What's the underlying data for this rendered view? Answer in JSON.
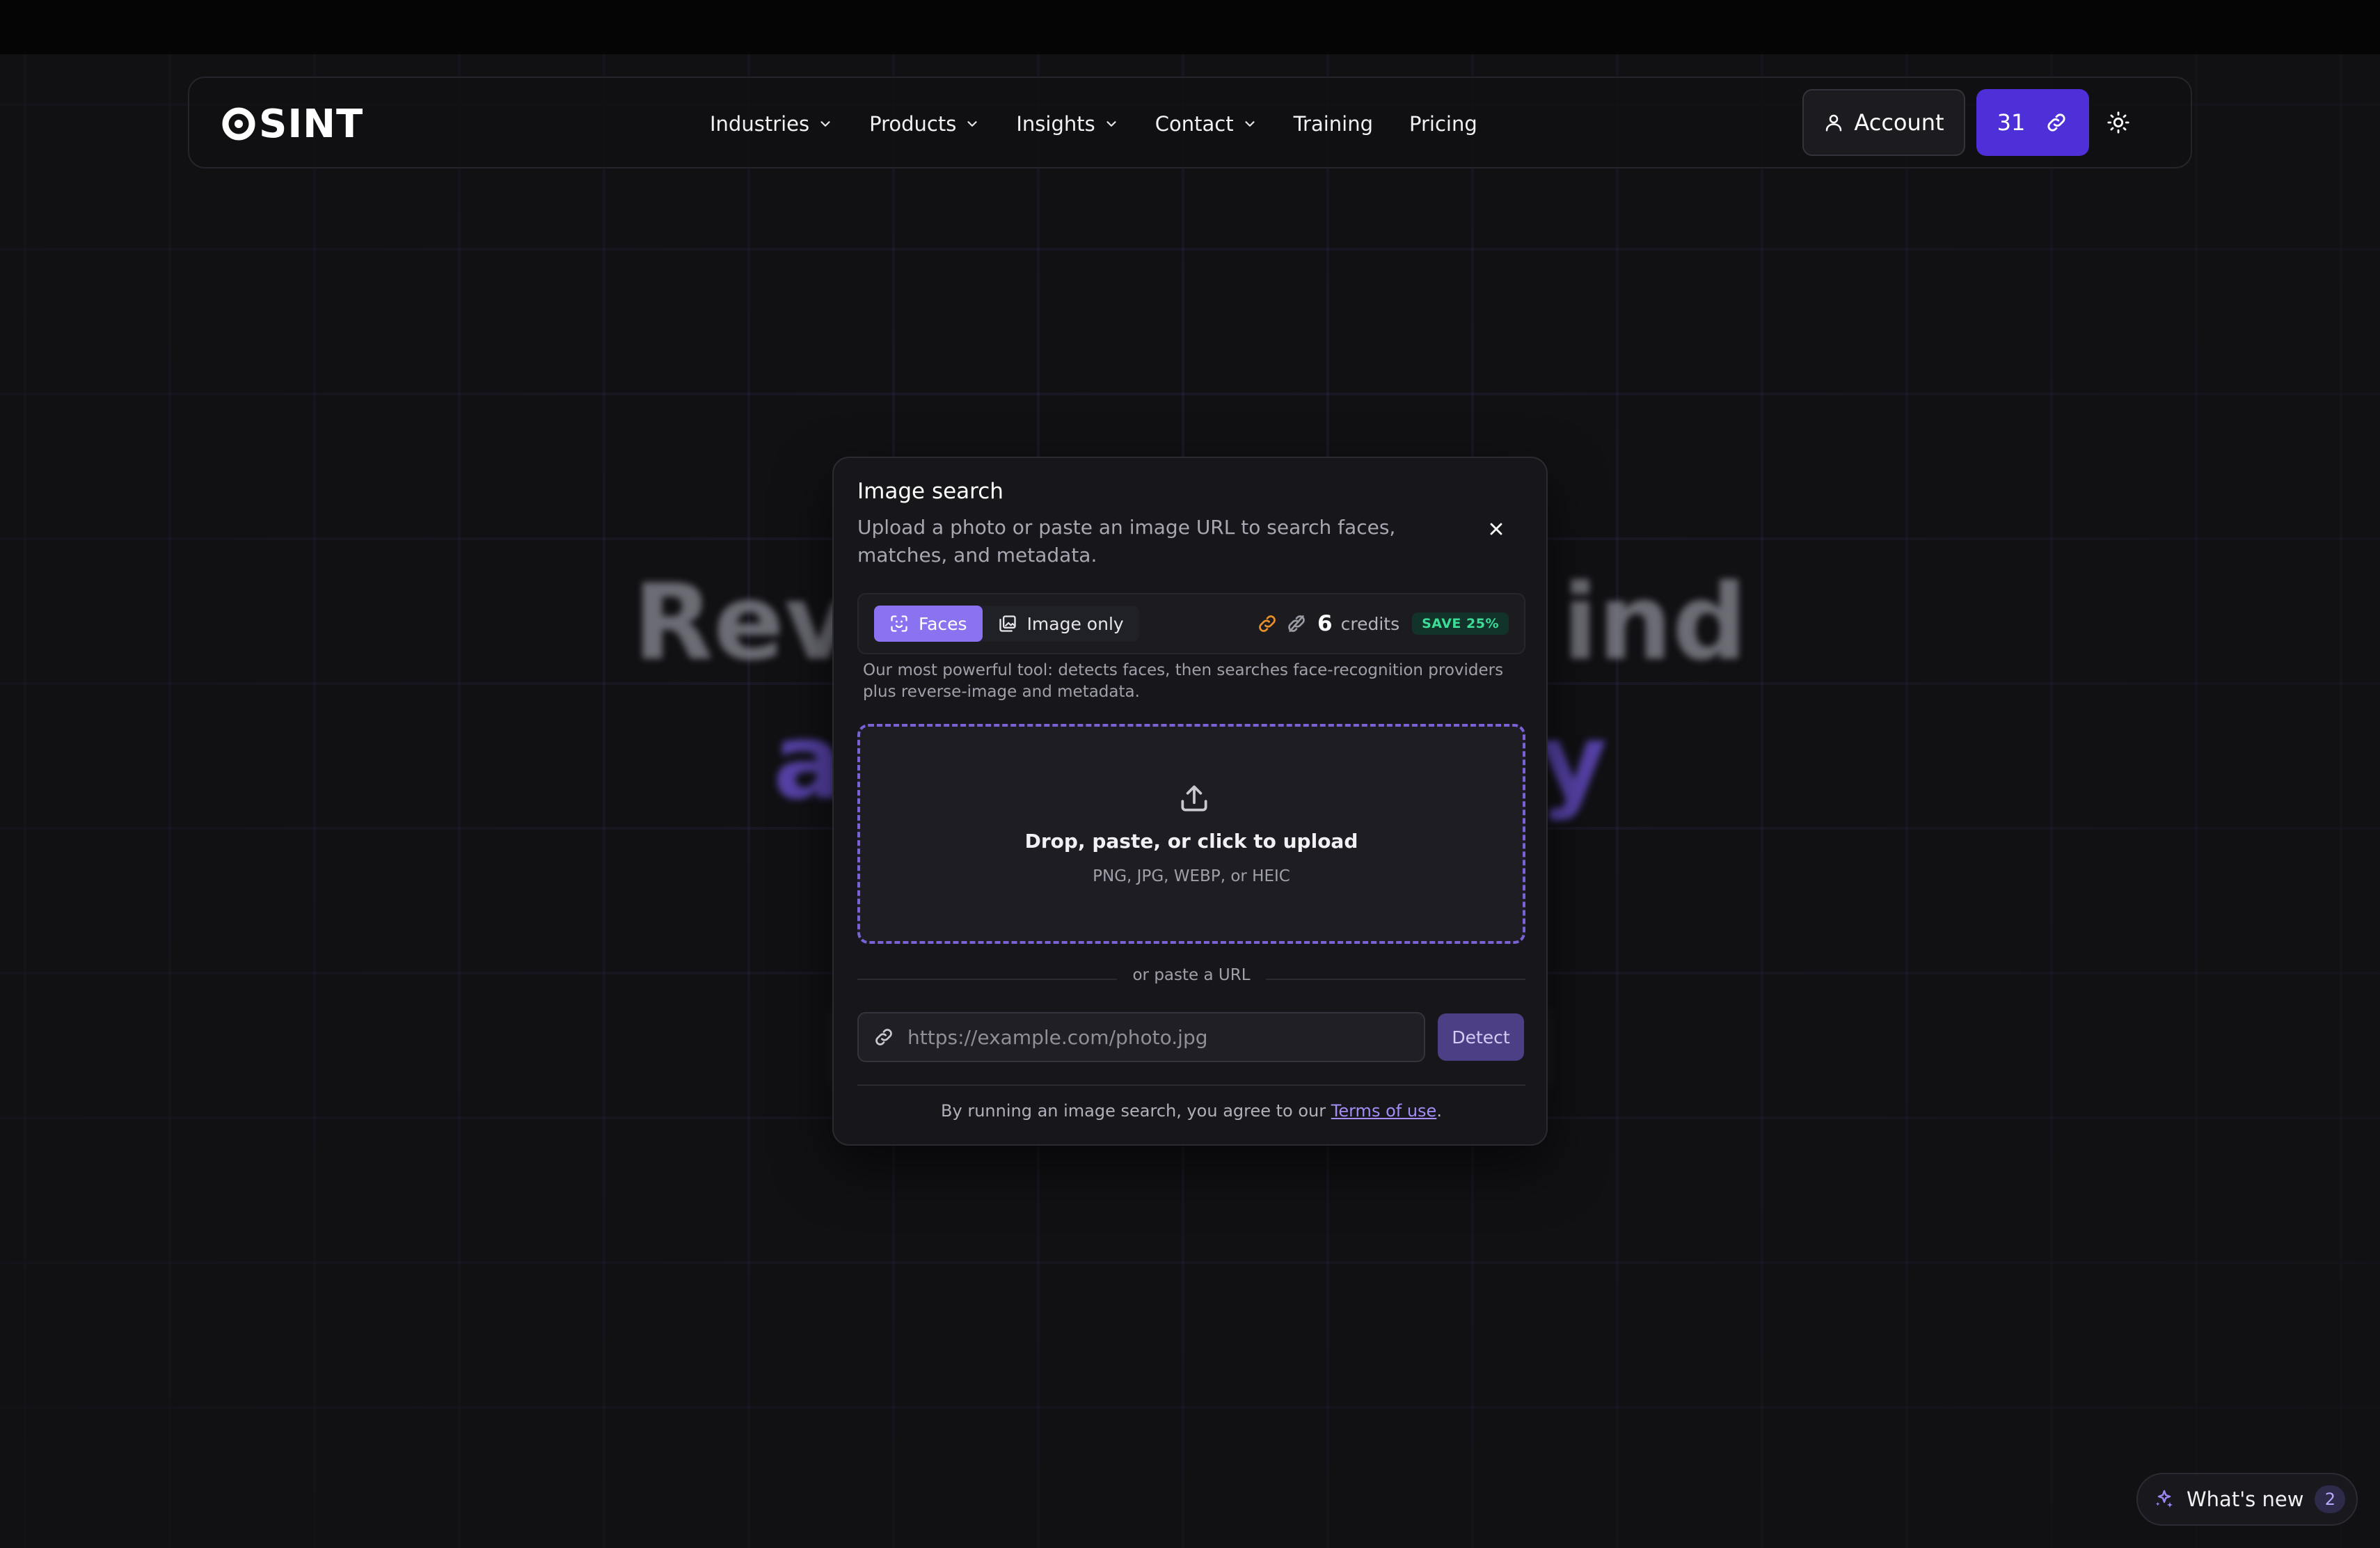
{
  "nav": {
    "logo_text": "SINT",
    "links": [
      {
        "label": "Industries",
        "has_menu": true
      },
      {
        "label": "Products",
        "has_menu": true
      },
      {
        "label": "Insights",
        "has_menu": true
      },
      {
        "label": "Contact",
        "has_menu": true
      },
      {
        "label": "Training",
        "has_menu": false
      },
      {
        "label": "Pricing",
        "has_menu": false
      }
    ],
    "account_label": "Account",
    "credits_count": "31",
    "icons": {
      "account": "user-icon",
      "credits": "link-icon",
      "theme": "sun-icon"
    }
  },
  "hero": {
    "line1_left": "Rev",
    "line1_right": "ind",
    "line2_left": "a",
    "line2_right": "y"
  },
  "modal": {
    "title": "Image search",
    "subtitle": "Upload a photo or paste an image URL to search faces, matches, and metadata.",
    "tabs": [
      {
        "label": "Faces",
        "active": true,
        "icon": "face-scan-icon"
      },
      {
        "label": "Image only",
        "active": false,
        "icon": "images-icon"
      }
    ],
    "credits_value": "6",
    "credits_label": "credits",
    "save_badge": "SAVE 25%",
    "description": "Our most powerful tool: detects faces, then searches face-recognition providers plus reverse-image and metadata.",
    "dropzone": {
      "title": "Drop, paste, or click to upload",
      "formats": "PNG, JPG, WEBP, or HEIC"
    },
    "divider_label": "or paste a URL",
    "url_placeholder": "https://example.com/photo.jpg",
    "url_value": "",
    "detect_label": "Detect",
    "terms_prefix": "By running an image search, you agree to our ",
    "terms_link": "Terms of use",
    "terms_suffix": "."
  },
  "whats_new": {
    "label": "What's new",
    "count": "2"
  },
  "colors": {
    "background": "#111114",
    "accent": "#4f2fd8",
    "tab_active": "#8b72f0",
    "dropzone_border": "#7a62d6",
    "save_badge": "#3ddc97",
    "credit_icon": "#e8912b"
  }
}
